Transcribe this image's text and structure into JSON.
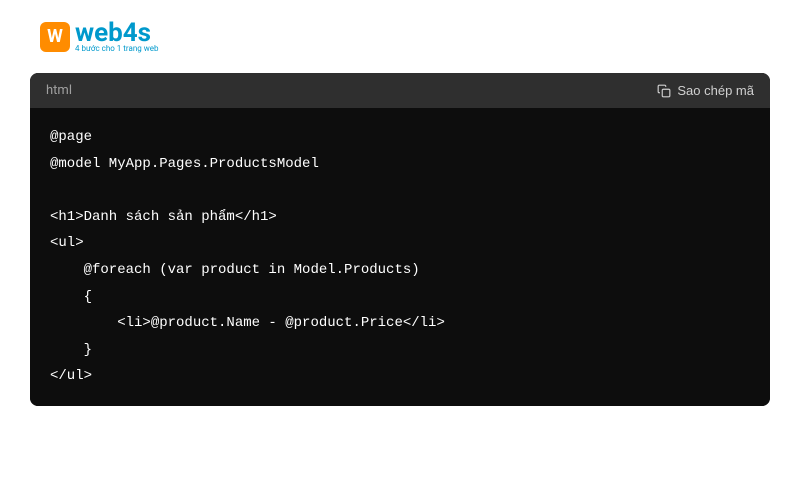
{
  "logo": {
    "icon_letter": "W",
    "text": "web4s",
    "subtitle": "4 bước cho 1 trang web"
  },
  "code_block": {
    "language": "html",
    "copy_label": "Sao chép mã",
    "content": "@page\n@model MyApp.Pages.ProductsModel\n\n<h1>Danh sách sản phẩm</h1>\n<ul>\n    @foreach (var product in Model.Products)\n    {\n        <li>@product.Name - @product.Price</li>\n    }\n</ul>"
  }
}
